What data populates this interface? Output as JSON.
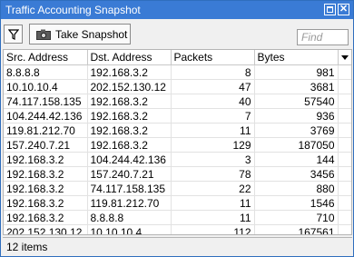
{
  "window": {
    "title": "Traffic Accounting Snapshot"
  },
  "toolbar": {
    "filter_icon": "filter-icon",
    "snapshot_label": "Take Snapshot",
    "snapshot_icon": "camera-icon",
    "find_placeholder": "Find"
  },
  "table": {
    "columns": [
      "Src. Address",
      "Dst. Address",
      "Packets",
      "Bytes"
    ],
    "rows": [
      {
        "src": "8.8.8.8",
        "dst": "192.168.3.2",
        "packets": "8",
        "bytes": "981"
      },
      {
        "src": "10.10.10.4",
        "dst": "202.152.130.12",
        "packets": "47",
        "bytes": "3681"
      },
      {
        "src": "74.117.158.135",
        "dst": "192.168.3.2",
        "packets": "40",
        "bytes": "57540"
      },
      {
        "src": "104.244.42.136",
        "dst": "192.168.3.2",
        "packets": "7",
        "bytes": "936"
      },
      {
        "src": "119.81.212.70",
        "dst": "192.168.3.2",
        "packets": "11",
        "bytes": "3769"
      },
      {
        "src": "157.240.7.21",
        "dst": "192.168.3.2",
        "packets": "129",
        "bytes": "187050"
      },
      {
        "src": "192.168.3.2",
        "dst": "104.244.42.136",
        "packets": "3",
        "bytes": "144"
      },
      {
        "src": "192.168.3.2",
        "dst": "157.240.7.21",
        "packets": "78",
        "bytes": "3456"
      },
      {
        "src": "192.168.3.2",
        "dst": "74.117.158.135",
        "packets": "22",
        "bytes": "880"
      },
      {
        "src": "192.168.3.2",
        "dst": "119.81.212.70",
        "packets": "11",
        "bytes": "1546"
      },
      {
        "src": "192.168.3.2",
        "dst": "8.8.8.8",
        "packets": "11",
        "bytes": "710"
      },
      {
        "src": "202.152.130.12",
        "dst": "10.10.10.4",
        "packets": "112",
        "bytes": "167561"
      }
    ]
  },
  "status": {
    "items_label": "12 items"
  },
  "colors": {
    "titlebar": "#3a7bd5",
    "border": "#2f6ebd"
  }
}
